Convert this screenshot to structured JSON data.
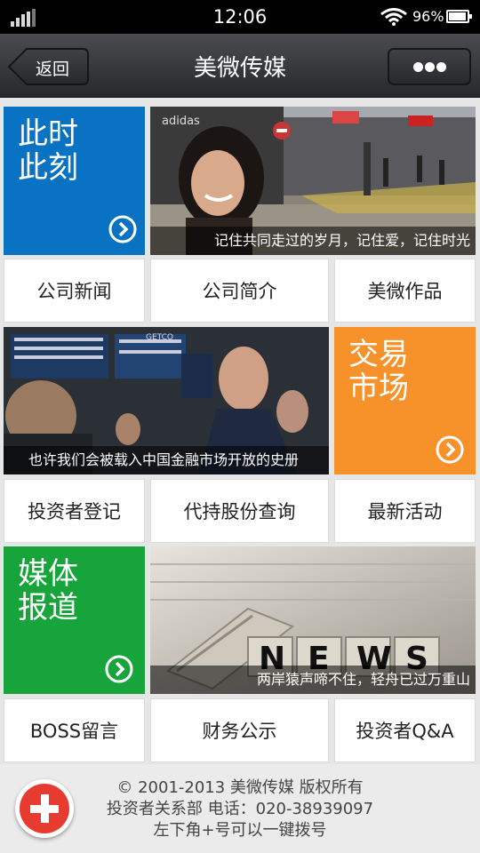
{
  "status_bar": {
    "time": "12:06",
    "battery": "96%",
    "battery_level": 0.96
  },
  "nav": {
    "back_label": "返回",
    "title": "美微传媒",
    "more_icon": "more-dots-icon"
  },
  "tiles": {
    "feature_1": {
      "title": "此时\n此刻",
      "color": "#0a72c2",
      "arrow_icon": "chevron-right-circle-icon"
    },
    "image_1": {
      "caption": "记住共同走过的岁月，记住爱，记住时光",
      "shop_sign": "adidas"
    },
    "feature_2": {
      "title": "交易\n市场",
      "color": "#f7922b",
      "arrow_icon": "chevron-right-circle-icon"
    },
    "image_2": {
      "caption": "也许我们会被载入中国金融市场开放的史册",
      "sign": "GETCO"
    },
    "feature_3": {
      "title": "媒体\n报道",
      "color": "#17a53b",
      "arrow_icon": "chevron-right-circle-icon"
    },
    "image_3": {
      "caption": "两岸猿声啼不住，轻舟已过万重山",
      "letters": [
        "N",
        "E",
        "W",
        "S"
      ]
    }
  },
  "links": {
    "row1": [
      "公司新闻",
      "公司简介",
      "美微作品"
    ],
    "row2": [
      "投资者登记",
      "代持股份查询",
      "最新活动"
    ],
    "row3": [
      "BOSS留言",
      "财务公示",
      "投资者Q&A"
    ]
  },
  "footer": {
    "copyright": "© 2001-2013 美微传媒 版权所有",
    "contact": "投资者关系部 电话：020-38939097",
    "hint": "左下角+号可以一键拨号",
    "call_icon": "plus-icon"
  }
}
